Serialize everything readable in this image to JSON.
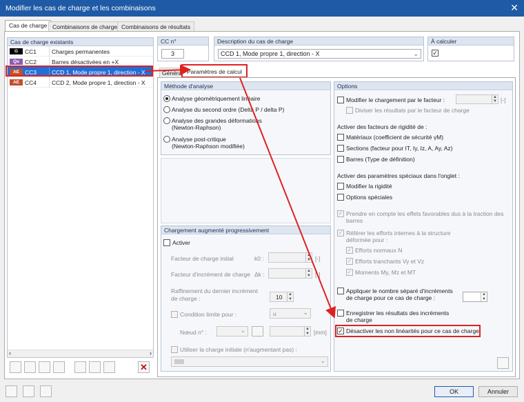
{
  "window": {
    "title": "Modifier les cas de charge et les combinaisons",
    "close_glyph": "✕"
  },
  "tabs": [
    "Cas de charge",
    "Combinaisons de charge",
    "Combinaisons de résultats"
  ],
  "left": {
    "header": "Cas de charge existants",
    "rows": [
      {
        "tag": "G",
        "tag_bg": "#000000",
        "id": "CC1",
        "desc": "Charges permanentes"
      },
      {
        "tag": "Qo",
        "tag_bg": "#8a5bb0",
        "id": "CC2",
        "desc": "Barres désactivées en +X"
      },
      {
        "tag": "AE",
        "tag_bg": "#c0502a",
        "id": "CC3",
        "desc": "CCD 1, Mode propre 1, direction - X"
      },
      {
        "tag": "AE",
        "tag_bg": "#c0502a",
        "id": "CC4",
        "desc": "CCD 2, Mode propre 1, direction - X"
      }
    ],
    "selected_index": 2
  },
  "top": {
    "cc_label": "CC n°",
    "cc_value": "3",
    "desc_label": "Description du cas de charge",
    "desc_value": "CCD 1, Mode propre 1, direction - X",
    "calc_label": "À calculer"
  },
  "subtabs": [
    "Généra",
    "Paramètres de calcul"
  ],
  "methode": {
    "header": "Méthode d'analyse",
    "options": [
      {
        "label": "Analyse géométriquement linéaire",
        "checked": true
      },
      {
        "label": "Analyse du second ordre (Delta P / delta P)",
        "checked": false
      },
      {
        "label": "Analyse des grandes déformations",
        "label2": "(Newton-Raphson)",
        "checked": false
      },
      {
        "label": "Analyse post-critique",
        "label2": "(Newton-Raphson modifiée)",
        "checked": false
      }
    ]
  },
  "chargement": {
    "header": "Chargement augmenté progressivement",
    "activer": "Activer",
    "facteur_initial": "Facteur de charge initial",
    "k0": "k0 :",
    "facteur_inc": "Facteur d'incrément de charge",
    "dk": "Δk :",
    "raffinement": "Raffinement du dernier incrément",
    "raffinement2": "de charge :",
    "raffinement_value": "10",
    "condition": "Condition limite pour :",
    "condition_value": "u",
    "noeud": "Nœud n° :",
    "unit": "[mm]",
    "unit_dash": "[-]",
    "utiliser": "Utiliser la charge initiale (n'augmentant pas) :"
  },
  "options": {
    "header": "Options",
    "modifier_facteur": "Modifier le chargement par le facteur :",
    "unit_dash": "[-]",
    "diviser": "Diviser les résultats par le facteur de charge",
    "rigidite_title": "Activer des facteurs de rigidité de :",
    "materiaux": "Matériaux (coefficient de sécurité γM)",
    "sections": "Sections (facteur pour IT, Iy, Iz, A, Ay, Az)",
    "barres": "Barres (Type de définition)",
    "speciaux_title": "Activer des paramètres spéciaux dans l'onglet :",
    "modifier_rigidite": "Modifier la rigidité",
    "options_speciales": "Options spéciales",
    "prendre": "Prendre en compte les effets favorables dus à la traction des",
    "prendre2": "barres",
    "referer": "Référer les efforts internes à la structure",
    "referer2": "déformée pour :",
    "efforts_normaux": "Efforts normaux N",
    "efforts_tranchants": "Efforts tranchants Vy et Vz",
    "moments": "Moments My, Mz et MT",
    "appliquer": "Appliquer le nombre séparé d'incréments",
    "appliquer2": "de charge pour ce cas de charge :",
    "enregistrer": "Enregistrer les résultats des incréments",
    "enregistrer2": "de charge",
    "desactiver": "Désactiver les non linéarités pour ce cas de charge"
  },
  "buttons": {
    "ok": "OK",
    "cancel": "Annuler"
  },
  "colors": {
    "accent": "#1f5aa6",
    "highlight": "#e02020",
    "selection": "#1f6fd8"
  }
}
